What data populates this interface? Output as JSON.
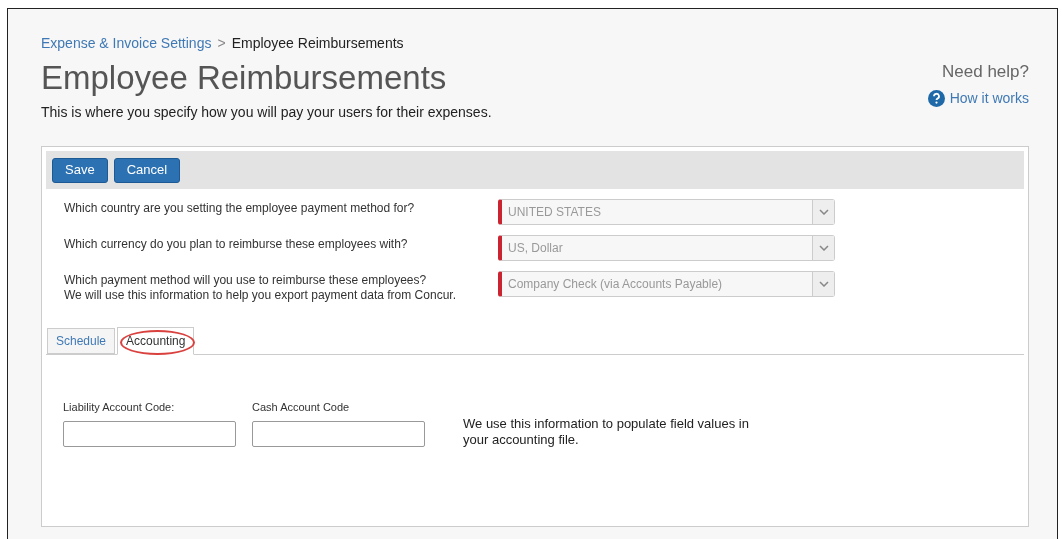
{
  "breadcrumb": {
    "parent": "Expense & Invoice Settings",
    "separator": ">",
    "current": "Employee Reimbursements"
  },
  "title": "Employee Reimbursements",
  "subtitle": "This is where you specify how you will pay your users for their expenses.",
  "help": {
    "heading": "Need help?",
    "link": "How it works"
  },
  "toolbar": {
    "buttons": [
      "Save",
      "Cancel"
    ]
  },
  "questions": [
    {
      "label": "Which country are you setting the employee payment method for?",
      "value": "UNITED STATES",
      "required": true
    },
    {
      "label": "Which currency do you plan to reimburse these employees with?",
      "value": "US, Dollar",
      "required": true
    },
    {
      "label": "Which payment method will you use to reimburse these employees?\nWe will use this information to help you export payment data from Concur.",
      "value": "Company Check (via Accounts Payable)",
      "required": true
    }
  ],
  "tabs": [
    {
      "label": "Schedule",
      "selected": false,
      "highlighted": false
    },
    {
      "label": "Accounting",
      "selected": true,
      "highlighted": true
    }
  ],
  "fields": [
    {
      "label": "Liability Account Code:"
    },
    {
      "label": "Cash Account Code"
    }
  ],
  "note": "We use this information to populate field values in\nyour accounting file."
}
